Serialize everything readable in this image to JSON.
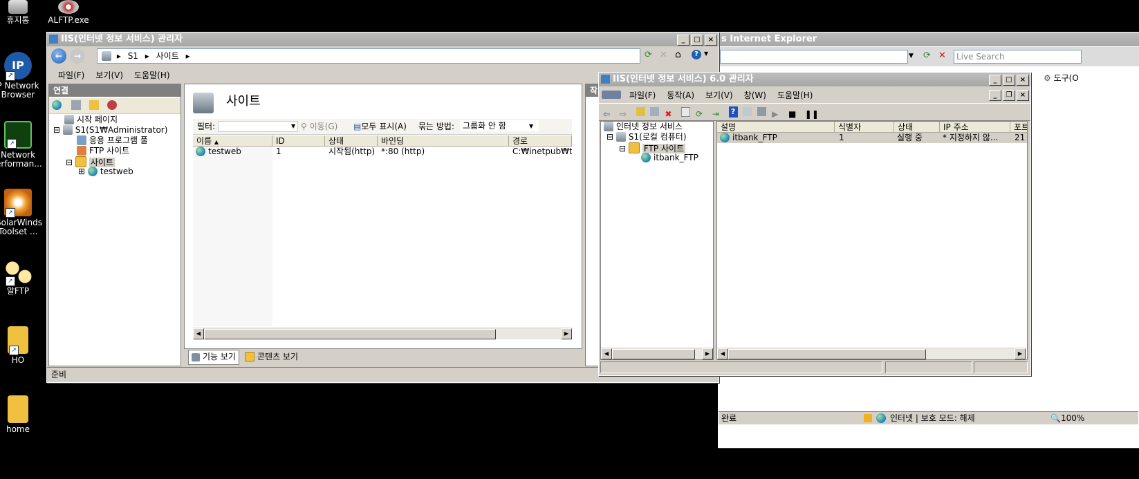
{
  "desktop": {
    "icons": [
      {
        "name": "recycle-bin",
        "label": "휴지통"
      },
      {
        "name": "alftp-exe",
        "label": "ALFTP.exe"
      },
      {
        "name": "ip-network-browser",
        "label": "P Network\nBrowser"
      },
      {
        "name": "network-performance",
        "label": "Network\nerforman..."
      },
      {
        "name": "solarwinds",
        "label": "SolarWinds\nToolset ..."
      },
      {
        "name": "alftp",
        "label": "알FTP"
      },
      {
        "name": "ho-folder",
        "label": "HO"
      },
      {
        "name": "home-folder",
        "label": "home"
      }
    ]
  },
  "ie_window": {
    "title_partial": "s Internet Explorer",
    "search_placeholder": "Live Search",
    "tools_label": "도구(O",
    "status_left": "완료",
    "status_zone": "인터넷 | 보호 모드: 해제",
    "zoom": "100%"
  },
  "iis7": {
    "title": "IIS(인터넷 정보 서비스) 관리자",
    "address": {
      "server": "S1",
      "node": "사이트"
    },
    "menu": [
      "파일(F)",
      "보기(V)",
      "도움말(H)"
    ],
    "connections_label": "연결",
    "tree": {
      "start_page": "시작 페이지",
      "server": "S1(S1₩Administrator)",
      "app_pools": "응용 프로그램 풀",
      "ftp_sites": "FTP 사이트",
      "sites": "사이트",
      "site1": "testweb"
    },
    "page_title": "사이트",
    "filter": {
      "label": "필터:",
      "go": "이동(G)",
      "show_all": "모두 표시(A)",
      "group_by": "묶는 방법:",
      "group_value": "그룹화 안 함"
    },
    "columns": [
      "이름",
      "ID",
      "상태",
      "바인딩",
      "경로"
    ],
    "rows": [
      {
        "name": "testweb",
        "id": "1",
        "status": "시작됨(http)",
        "binding": "*:80 (http)",
        "path": "C:₩inetpub₩tes"
      }
    ],
    "views": {
      "feature": "기능 보기",
      "content": "콘텐츠 보기"
    },
    "status": "준비",
    "actions_partial": "작"
  },
  "iis6": {
    "title": "IIS(인터넷 정보 서비스) 6.0 관리자",
    "menu": [
      "파일(F)",
      "동작(A)",
      "보기(V)",
      "창(W)",
      "도움말(H)"
    ],
    "tree": {
      "root": "인터넷 정보 서비스",
      "server": "S1(로컬 컴퓨터)",
      "ftp": "FTP 사이트",
      "site": "itbank_FTP"
    },
    "columns": [
      "설명",
      "식별자",
      "상태",
      "IP 주소",
      "포트"
    ],
    "rows": [
      {
        "desc": "itbank_FTP",
        "id": "1",
        "status": "실행 중",
        "ip": "* 지정하지 않...",
        "port": "21"
      }
    ]
  }
}
